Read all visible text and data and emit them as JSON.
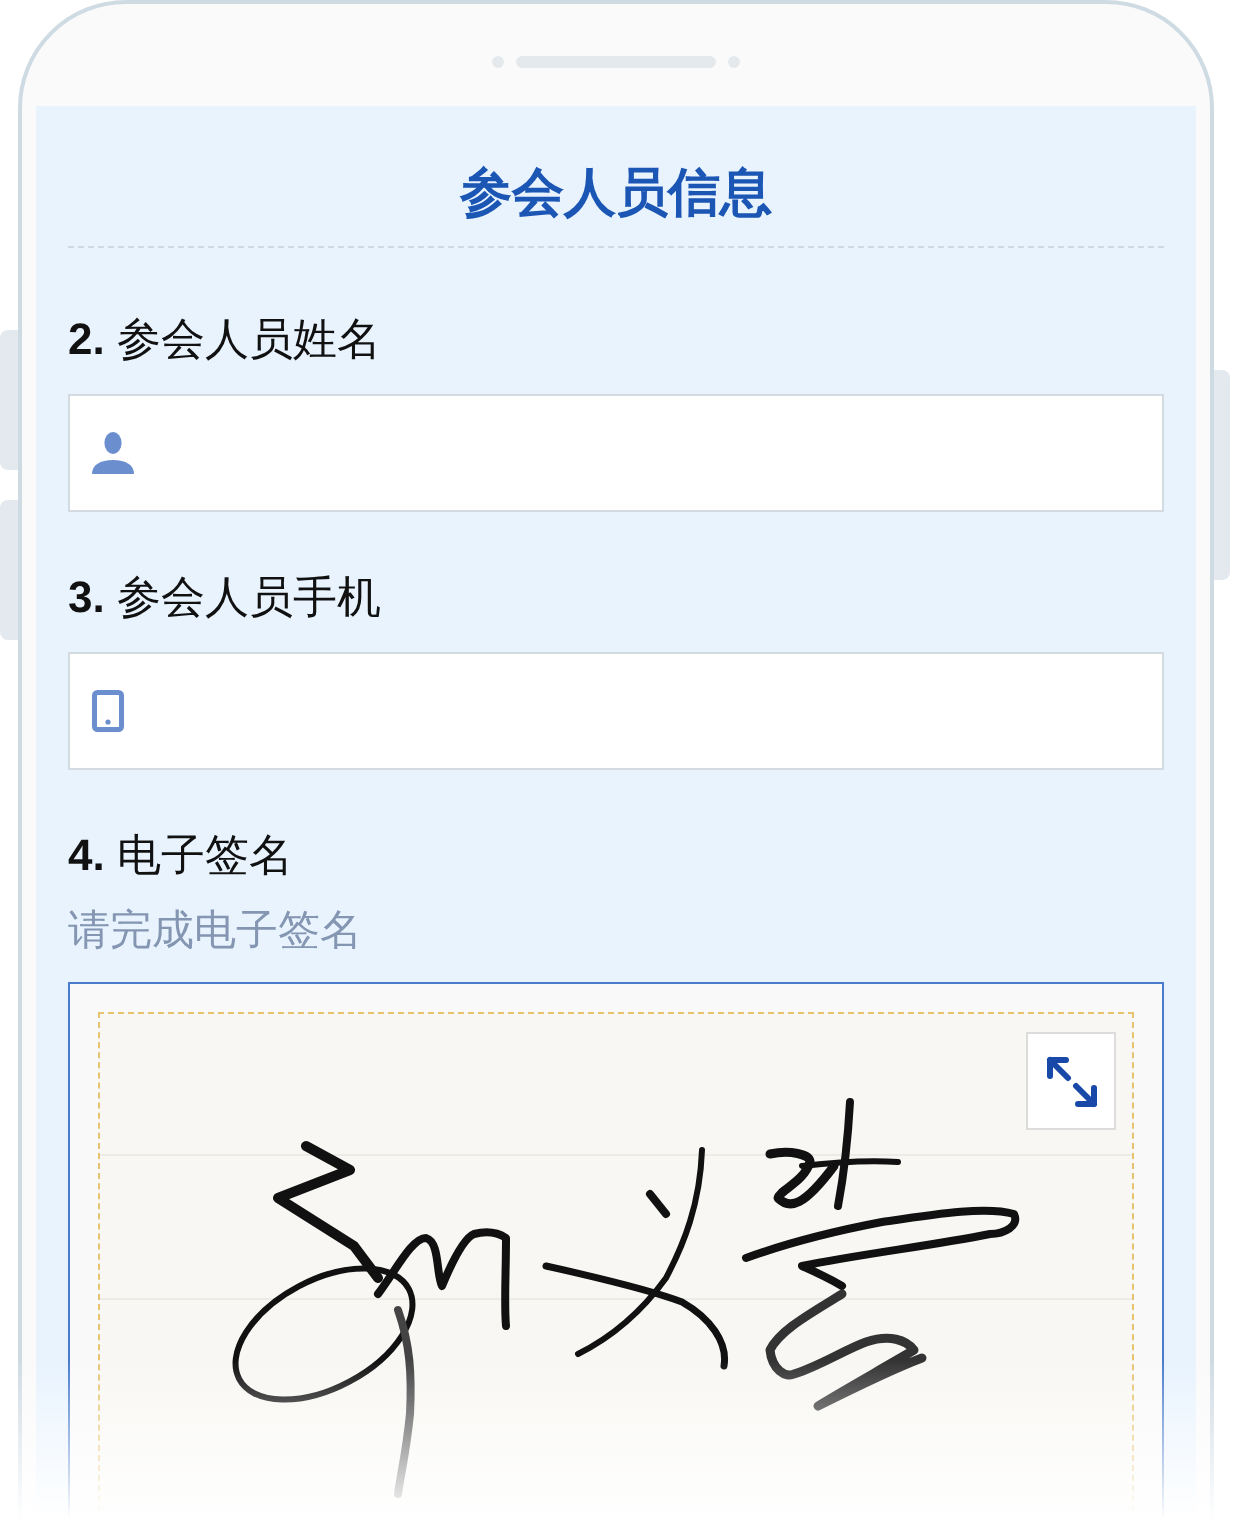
{
  "title": "参会人员信息",
  "fields": [
    {
      "kind": "text",
      "label": "**2.** 参会人员姓名"
    },
    {
      "kind": "phone",
      "label": "**3.** 参会人员手机"
    },
    {
      "kind": "signature",
      "label": "**4.** 电子签名",
      "hint": "请完成电子签名"
    }
  ]
}
